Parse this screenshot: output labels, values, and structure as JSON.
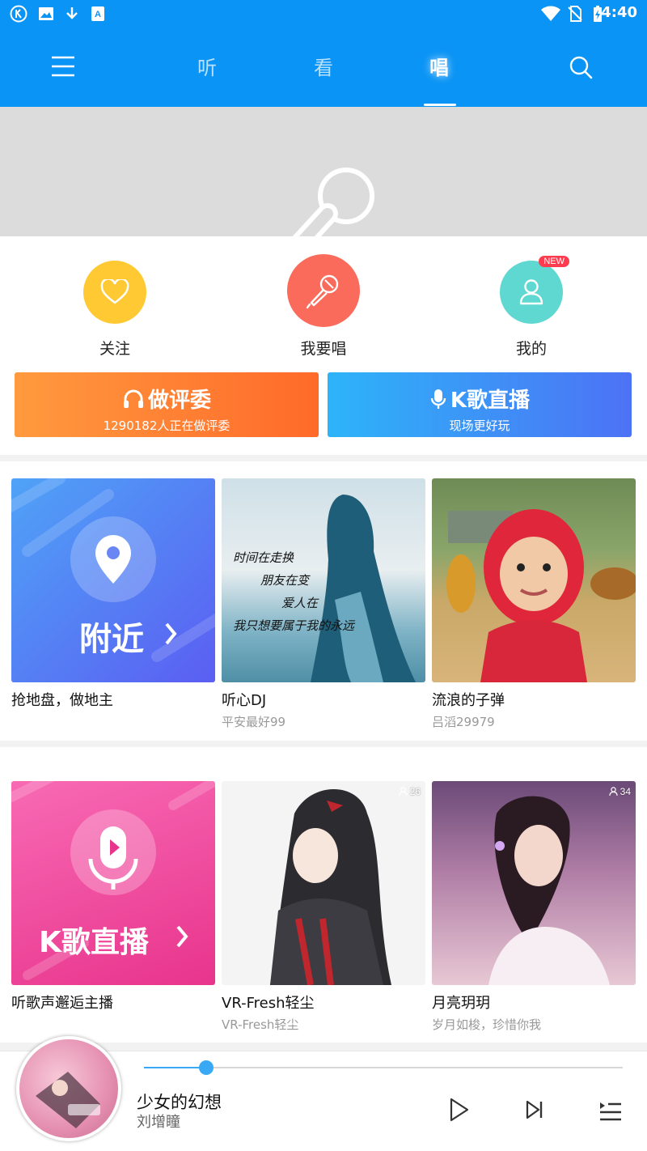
{
  "status_bar": {
    "time": "4:40",
    "left_icons": [
      "k-app-icon",
      "image-icon",
      "download-icon",
      "app-store-icon"
    ],
    "right_icons": [
      "wifi-icon",
      "no-sim-icon",
      "battery-charging-icon"
    ]
  },
  "nav": {
    "tabs": [
      {
        "label": "听",
        "active": false
      },
      {
        "label": "看",
        "active": false
      },
      {
        "label": "唱",
        "active": true
      }
    ]
  },
  "quick_actions": [
    {
      "label": "关注",
      "icon": "heart-icon",
      "color": "#ffc934"
    },
    {
      "label": "我要唱",
      "icon": "microphone-icon",
      "color": "#fb6b5b"
    },
    {
      "label": "我的",
      "icon": "user-icon",
      "color": "#5fd8d1",
      "badge": "NEW"
    }
  ],
  "big_buttons": {
    "judge": {
      "title": "做评委",
      "subtitle": "1290182人正在做评委"
    },
    "live": {
      "title": "K歌直播",
      "subtitle": "现场更好玩"
    }
  },
  "grid1": [
    {
      "name": "抢地盘，做地主",
      "sub": "",
      "image_text": "附近",
      "image_type": "nearby"
    },
    {
      "name": "听心DJ",
      "sub": "平安最好99",
      "image_lines": [
        "时间在走换",
        "朋友在变",
        "爱人在",
        "我只想要属于我的永远"
      ],
      "image_type": "photo-girl"
    },
    {
      "name": "流浪的子弹",
      "sub": "吕滔29979",
      "image_type": "photo-kid"
    }
  ],
  "grid2": [
    {
      "name": "听歌声邂逅主播",
      "sub": "",
      "image_text": "K歌直播",
      "image_type": "live"
    },
    {
      "name": "VR-Fresh轻尘",
      "sub": "VR-Fresh轻尘",
      "count": "26",
      "image_type": "anime"
    },
    {
      "name": "月亮玥玥",
      "sub": "岁月如梭，珍惜你我",
      "count": "34",
      "image_type": "portrait"
    }
  ],
  "player": {
    "title": "少女的幻想",
    "artist": "刘增瞳",
    "progress": 0.13
  },
  "colors": {
    "brand_blue": "#0a94f5",
    "judge_gradient": [
      "#ff9a3e",
      "#ff6a2a"
    ],
    "live_gradient": [
      "#2db4f8",
      "#4d72f5"
    ]
  }
}
